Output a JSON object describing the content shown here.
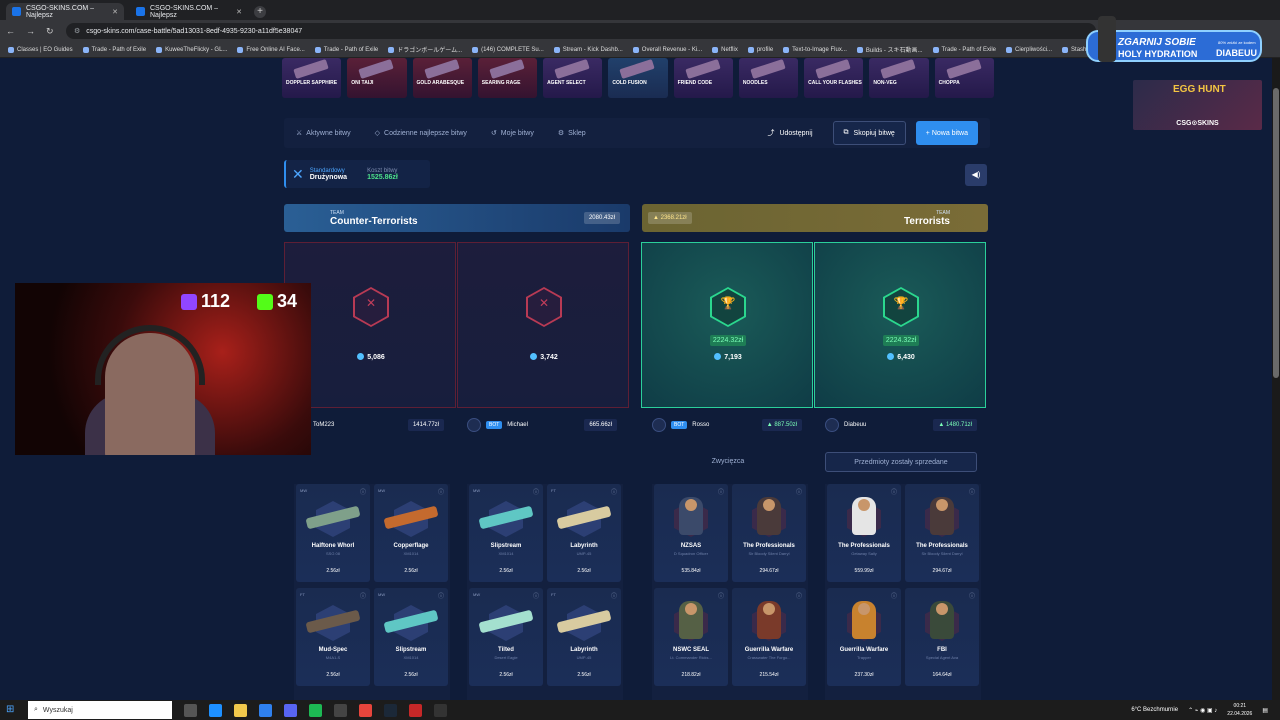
{
  "browser": {
    "tabs": [
      {
        "label": "CSGO-SKINS.COM – Najlepsz",
        "active": true
      },
      {
        "label": "CSGO-SKINS.COM – Najlepsz",
        "active": false
      }
    ],
    "url": "csgo-skins.com/case-battle/5ad13031-8edf-4935-9230-a11df5e38047",
    "bookmarks": [
      "Classes | EO Guides",
      "Trade - Path of Exile",
      "KuweeTheFlicky - GL...",
      "Free Online AI Face...",
      "Trade - Path of Exile",
      "ドラゴンボールゲーム...",
      "(146) COMPLETE Su...",
      "Stream - Kick Dashb...",
      "Overall Revenue - Ki...",
      "Netflix",
      "profile",
      "Text-to-Image Flux...",
      "Builds - スキ石動画...",
      "Trade - Path of Exile",
      "Cierpliwości...",
      "Stash"
    ]
  },
  "livedrops": [
    {
      "name": "DOPPLER SAPPHIRE",
      "tone": "purple"
    },
    {
      "name": "ONI TAIJI",
      "tone": "red"
    },
    {
      "name": "GOLD ARABESQUE",
      "tone": "red"
    },
    {
      "name": "SEARING RAGE",
      "tone": "red"
    },
    {
      "name": "AGENT SELECT",
      "tone": "purple"
    },
    {
      "name": "COLD FUSION",
      "tone": "blue"
    },
    {
      "name": "FRIEND CODE",
      "tone": "purple"
    },
    {
      "name": "NOODLES",
      "tone": "purple"
    },
    {
      "name": "CALL YOUR FLASHES",
      "tone": "purple"
    },
    {
      "name": "NON-VEG",
      "tone": "purple"
    },
    {
      "name": "CHOPPA",
      "tone": "purple"
    }
  ],
  "nav": {
    "active_battles": "Aktywne bitwy",
    "daily_best": "Codzienne najlepsze bitwy",
    "my_battles": "Moje bitwy",
    "shop": "Sklep",
    "share": "Udostępnij",
    "copy_battle": "Skopiuj bitwę",
    "new_battle": "+ Nowa bitwa"
  },
  "mode": {
    "type": "Standardowy",
    "name": "Drużynowa",
    "cost_label": "Koszt bitwy",
    "cost_value": "1525.86zł"
  },
  "teams": {
    "ct": {
      "small": "TEAM",
      "name": "Counter-Terrorists",
      "value": "2080.43zł"
    },
    "t": {
      "small": "TEAM",
      "name": "Terrorists",
      "value": "2368.21zł"
    }
  },
  "slots": [
    {
      "result": "lose",
      "coins": "5,086",
      "amount": ""
    },
    {
      "result": "lose",
      "coins": "3,742",
      "amount": ""
    },
    {
      "result": "win",
      "coins": "7,193",
      "amount": "2224.32zł"
    },
    {
      "result": "win",
      "coins": "6,430",
      "amount": "2224.32zł"
    }
  ],
  "players": [
    {
      "name": "ToM223",
      "bot": false,
      "value": "1414.77zł"
    },
    {
      "name": "Michael",
      "bot": true,
      "bot_label": "BOT",
      "value": "665.66zł"
    },
    {
      "name": "Rosso",
      "bot": true,
      "bot_label": "BOT",
      "value": "887.50zł"
    },
    {
      "name": "Diabeuu",
      "bot": false,
      "value": "1480.71zł"
    }
  ],
  "status": {
    "winners": "Zwycięzca",
    "sold": "Przedmioty zostały sprzedane"
  },
  "columns": [
    {
      "items": [
        {
          "cond": "MW",
          "name": "Halftone Whorl",
          "sub": "SSG 08",
          "price": "2.56zł",
          "kind": "gun",
          "color": "#7fa08a"
        },
        {
          "cond": "MW",
          "name": "Copperflage",
          "sub": "XM1014",
          "price": "2.56zł",
          "kind": "gun",
          "color": "#c46a2e"
        },
        {
          "cond": "FT",
          "name": "Mud-Spec",
          "sub": "M4A1-S",
          "price": "2.56zł",
          "kind": "gun",
          "color": "#6b5a4a"
        },
        {
          "cond": "MW",
          "name": "Slipstream",
          "sub": "XM1014",
          "price": "2.56zł",
          "kind": "gun",
          "color": "#5fc7c4"
        }
      ]
    },
    {
      "items": [
        {
          "cond": "MW",
          "name": "Slipstream",
          "sub": "XM1014",
          "price": "2.56zł",
          "kind": "gun",
          "color": "#5fc7c4"
        },
        {
          "cond": "FT",
          "name": "Labyrinth",
          "sub": "UMP-45",
          "price": "2.56zł",
          "kind": "gun",
          "color": "#d8cba0"
        },
        {
          "cond": "MW",
          "name": "Tilted",
          "sub": "Desert Eagle",
          "price": "2.56zł",
          "kind": "gun",
          "color": "#a4e0cf"
        },
        {
          "cond": "FT",
          "name": "Labyrinth",
          "sub": "UMP-45",
          "price": "2.56zł",
          "kind": "gun",
          "color": "#d8cba0"
        }
      ]
    },
    {
      "items": [
        {
          "cond": "",
          "name": "NZSAS",
          "sub": "D Squadron Officer",
          "price": "535.84zł",
          "kind": "agent",
          "color": "#3b4a6a"
        },
        {
          "cond": "",
          "name": "The Professionals",
          "sub": "Sir Bloody Silent Darryl",
          "price": "294.67zł",
          "kind": "agent",
          "color": "#4a3a3a"
        },
        {
          "cond": "",
          "name": "NSWC SEAL",
          "sub": "Lt. Commander Ricks...",
          "price": "218.82zł",
          "kind": "agent",
          "color": "#556045"
        },
        {
          "cond": "",
          "name": "Guerrilla Warfare",
          "sub": "Crasswater The Forgo...",
          "price": "215.54zł",
          "kind": "agent",
          "color": "#7a3a2a"
        }
      ]
    },
    {
      "items": [
        {
          "cond": "",
          "name": "The Professionals",
          "sub": "Getaway Sally",
          "price": "559.99zł",
          "kind": "agent",
          "color": "#e5e5e5"
        },
        {
          "cond": "",
          "name": "The Professionals",
          "sub": "Sir Bloody Silent Darryl",
          "price": "294.67zł",
          "kind": "agent",
          "color": "#4a3a3a"
        },
        {
          "cond": "",
          "name": "Guerrilla Warfare",
          "sub": "Trapper",
          "price": "237.30zł",
          "kind": "agent",
          "color": "#c8822e"
        },
        {
          "cond": "",
          "name": "FBI",
          "sub": "Special Agent Ava",
          "price": "164.64zł",
          "kind": "agent",
          "color": "#3a4a3a"
        }
      ]
    }
  ],
  "webcam": {
    "twitch_count": "112",
    "kick_count": "34",
    "twitch_color": "#9146ff",
    "kick_color": "#53fc18"
  },
  "overlay": {
    "line1": "ZGARNIJ SOBIE",
    "line2": "HOLY HYDRATION",
    "small": "80% zniżki ze kodem",
    "code": "DIABEUU"
  },
  "promo": {
    "title": "EGG HUNT",
    "brand": "CSG⊙SKINS"
  },
  "taskbar": {
    "search": "Wyszukaj",
    "weather": "6°C  Bezchmurnie",
    "time": "00:21",
    "date": "22.04.2026"
  }
}
